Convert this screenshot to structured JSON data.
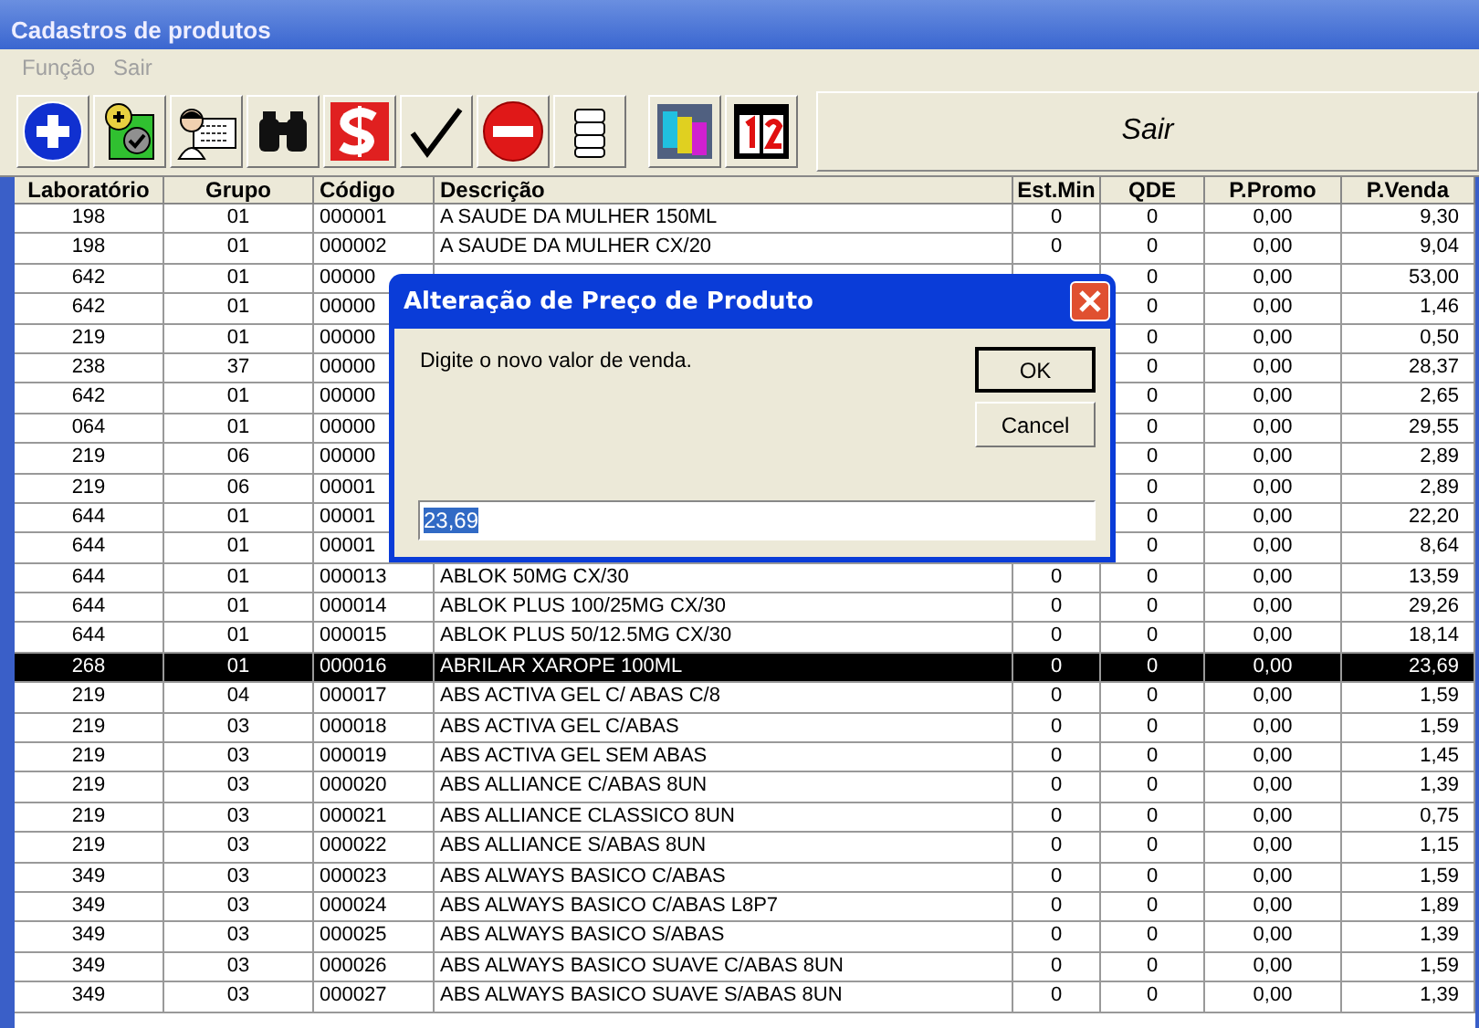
{
  "window": {
    "title": "Cadastros de produtos"
  },
  "menu": [
    {
      "label": "Função",
      "disabled": true
    },
    {
      "label": "Sair",
      "disabled": true
    }
  ],
  "toolbar": {
    "buttons": [
      {
        "kind": "add"
      },
      {
        "kind": "approve"
      },
      {
        "kind": "card"
      },
      {
        "kind": "binoculars"
      },
      {
        "kind": "dollar"
      },
      {
        "kind": "check"
      },
      {
        "kind": "stop"
      },
      {
        "kind": "list"
      },
      {
        "kind": "numbers"
      },
      {
        "kind": "calendar"
      }
    ],
    "exit_label": "Sair"
  },
  "table": {
    "columns": [
      "Laboratório",
      "Grupo",
      "Código",
      "Descrição",
      "Est.Min",
      "QDE",
      "P.Promo",
      "P.Venda"
    ],
    "rows": [
      {
        "lab": "198",
        "grupo": "01",
        "codigo": "000001",
        "descricao": "A SAUDE DA MULHER 150ML",
        "est_min": "0",
        "qde": "0",
        "p_promo": "0,00",
        "p_venda": "9,30",
        "selected": false
      },
      {
        "lab": "198",
        "grupo": "01",
        "codigo": "000002",
        "descricao": "A SAUDE DA MULHER CX/20",
        "est_min": "0",
        "qde": "0",
        "p_promo": "0,00",
        "p_venda": "9,04",
        "selected": false
      },
      {
        "lab": "642",
        "grupo": "01",
        "codigo": "00000",
        "qde": "0",
        "p_promo": "0,00",
        "p_venda": "53,00",
        "selected": false
      },
      {
        "lab": "642",
        "grupo": "01",
        "codigo": "00000",
        "qde": "0",
        "p_promo": "0,00",
        "p_venda": "1,46",
        "selected": false
      },
      {
        "lab": "219",
        "grupo": "01",
        "codigo": "00000",
        "qde": "0",
        "p_promo": "0,00",
        "p_venda": "0,50",
        "selected": false
      },
      {
        "lab": "238",
        "grupo": "37",
        "codigo": "00000",
        "qde": "0",
        "p_promo": "0,00",
        "p_venda": "28,37",
        "selected": false
      },
      {
        "lab": "642",
        "grupo": "01",
        "codigo": "00000",
        "qde": "0",
        "p_promo": "0,00",
        "p_venda": "2,65",
        "selected": false
      },
      {
        "lab": "064",
        "grupo": "01",
        "codigo": "00000",
        "qde": "0",
        "p_promo": "0,00",
        "p_venda": "29,55",
        "selected": false
      },
      {
        "lab": "219",
        "grupo": "06",
        "codigo": "00000",
        "qde": "0",
        "p_promo": "0,00",
        "p_venda": "2,89",
        "selected": false
      },
      {
        "lab": "219",
        "grupo": "06",
        "codigo": "00001",
        "qde": "0",
        "p_promo": "0,00",
        "p_venda": "2,89",
        "selected": false
      },
      {
        "lab": "644",
        "grupo": "01",
        "codigo": "00001",
        "qde": "0",
        "p_promo": "0,00",
        "p_venda": "22,20",
        "selected": false
      },
      {
        "lab": "644",
        "grupo": "01",
        "codigo": "00001",
        "qde": "0",
        "p_promo": "0,00",
        "p_venda": "8,64",
        "selected": false
      },
      {
        "lab": "644",
        "grupo": "01",
        "codigo": "000013",
        "descricao": "ABLOK 50MG CX/30",
        "est_min": "0",
        "qde": "0",
        "p_promo": "0,00",
        "p_venda": "13,59",
        "selected": false
      },
      {
        "lab": "644",
        "grupo": "01",
        "codigo": "000014",
        "descricao": "ABLOK PLUS 100/25MG CX/30",
        "est_min": "0",
        "qde": "0",
        "p_promo": "0,00",
        "p_venda": "29,26",
        "selected": false
      },
      {
        "lab": "644",
        "grupo": "01",
        "codigo": "000015",
        "descricao": "ABLOK PLUS 50/12.5MG CX/30",
        "est_min": "0",
        "qde": "0",
        "p_promo": "0,00",
        "p_venda": "18,14",
        "selected": false
      },
      {
        "lab": "268",
        "grupo": "01",
        "codigo": "000016",
        "descricao": "ABRILAR XAROPE 100ML",
        "est_min": "0",
        "qde": "0",
        "p_promo": "0,00",
        "p_venda": "23,69",
        "selected": true
      },
      {
        "lab": "219",
        "grupo": "04",
        "codigo": "000017",
        "descricao": "ABS ACTIVA GEL C/ ABAS C/8",
        "est_min": "0",
        "qde": "0",
        "p_promo": "0,00",
        "p_venda": "1,59",
        "selected": false
      },
      {
        "lab": "219",
        "grupo": "03",
        "codigo": "000018",
        "descricao": "ABS ACTIVA GEL C/ABAS",
        "est_min": "0",
        "qde": "0",
        "p_promo": "0,00",
        "p_venda": "1,59",
        "selected": false
      },
      {
        "lab": "219",
        "grupo": "03",
        "codigo": "000019",
        "descricao": "ABS ACTIVA GEL SEM ABAS",
        "est_min": "0",
        "qde": "0",
        "p_promo": "0,00",
        "p_venda": "1,45",
        "selected": false
      },
      {
        "lab": "219",
        "grupo": "03",
        "codigo": "000020",
        "descricao": "ABS ALLIANCE C/ABAS 8UN",
        "est_min": "0",
        "qde": "0",
        "p_promo": "0,00",
        "p_venda": "1,39",
        "selected": false
      },
      {
        "lab": "219",
        "grupo": "03",
        "codigo": "000021",
        "descricao": "ABS ALLIANCE CLASSICO 8UN",
        "est_min": "0",
        "qde": "0",
        "p_promo": "0,00",
        "p_venda": "0,75",
        "selected": false
      },
      {
        "lab": "219",
        "grupo": "03",
        "codigo": "000022",
        "descricao": "ABS ALLIANCE S/ABAS 8UN",
        "est_min": "0",
        "qde": "0",
        "p_promo": "0,00",
        "p_venda": "1,15",
        "selected": false
      },
      {
        "lab": "349",
        "grupo": "03",
        "codigo": "000023",
        "descricao": "ABS ALWAYS BASICO C/ABAS",
        "est_min": "0",
        "qde": "0",
        "p_promo": "0,00",
        "p_venda": "1,59",
        "selected": false
      },
      {
        "lab": "349",
        "grupo": "03",
        "codigo": "000024",
        "descricao": "ABS ALWAYS BASICO C/ABAS L8P7",
        "est_min": "0",
        "qde": "0",
        "p_promo": "0,00",
        "p_venda": "1,89",
        "selected": false
      },
      {
        "lab": "349",
        "grupo": "03",
        "codigo": "000025",
        "descricao": "ABS ALWAYS BASICO S/ABAS",
        "est_min": "0",
        "qde": "0",
        "p_promo": "0,00",
        "p_venda": "1,39",
        "selected": false
      },
      {
        "lab": "349",
        "grupo": "03",
        "codigo": "000026",
        "descricao": "ABS ALWAYS BASICO SUAVE C/ABAS 8UN",
        "est_min": "0",
        "qde": "0",
        "p_promo": "0,00",
        "p_venda": "1,59",
        "selected": false
      },
      {
        "lab": "349",
        "grupo": "03",
        "codigo": "000027",
        "descricao": "ABS ALWAYS BASICO SUAVE S/ABAS 8UN",
        "est_min": "0",
        "qde": "0",
        "p_promo": "0,00",
        "p_venda": "1,39",
        "selected": false
      }
    ]
  },
  "dialog": {
    "title": "Alteração de Preço de Produto",
    "message": "Digite o novo valor de venda.",
    "buttons": [
      {
        "label": "OK",
        "default": true
      },
      {
        "label": "Cancel",
        "default": false
      }
    ],
    "input": {
      "value": "23,69",
      "value_selected": true
    }
  }
}
